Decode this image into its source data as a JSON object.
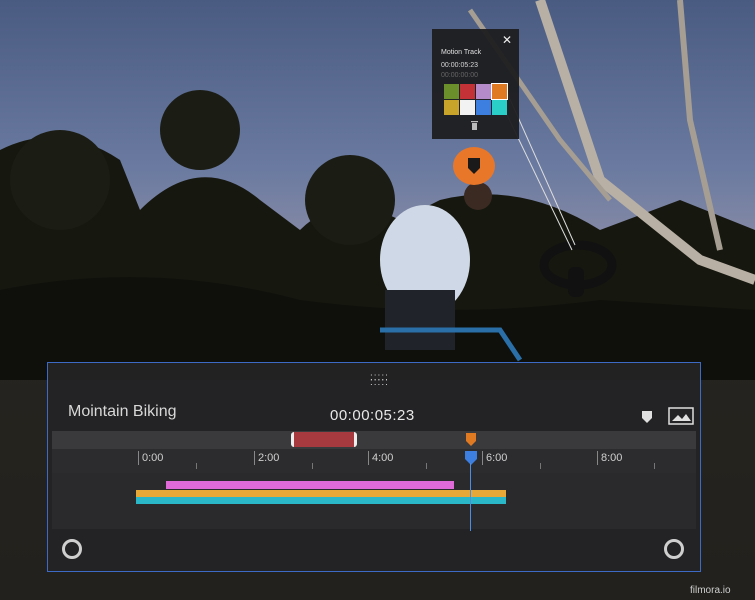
{
  "scene": {
    "description_icon": "mountain-biker-vr-background"
  },
  "popup": {
    "title": "Motion Track",
    "timecode": "00:00:05:23",
    "timecode_secondary": "00:00:00:00",
    "close_icon": "close-icon",
    "swatches": [
      "#6b8f2a",
      "#c23236",
      "#b58cc9",
      "#e07a22",
      "#c8a42a",
      "#f2f2f2",
      "#3d7fe0",
      "#2ad0c8"
    ]
  },
  "panel": {
    "title": "Mointain Biking",
    "timecode": "00:00:05:23",
    "ruler": [
      "0:00",
      "2:00",
      "4:00",
      "6:00",
      "8:00"
    ],
    "colors": {
      "accent": "#3d6ac4",
      "clip": "#a73a3e",
      "keyframe": "#e07a22",
      "playhead": "#3d7fe0",
      "pink": "#e06ad8",
      "orange": "#e8a838",
      "cyan": "#2ab8c8"
    }
  },
  "watermark": "filmora.io"
}
